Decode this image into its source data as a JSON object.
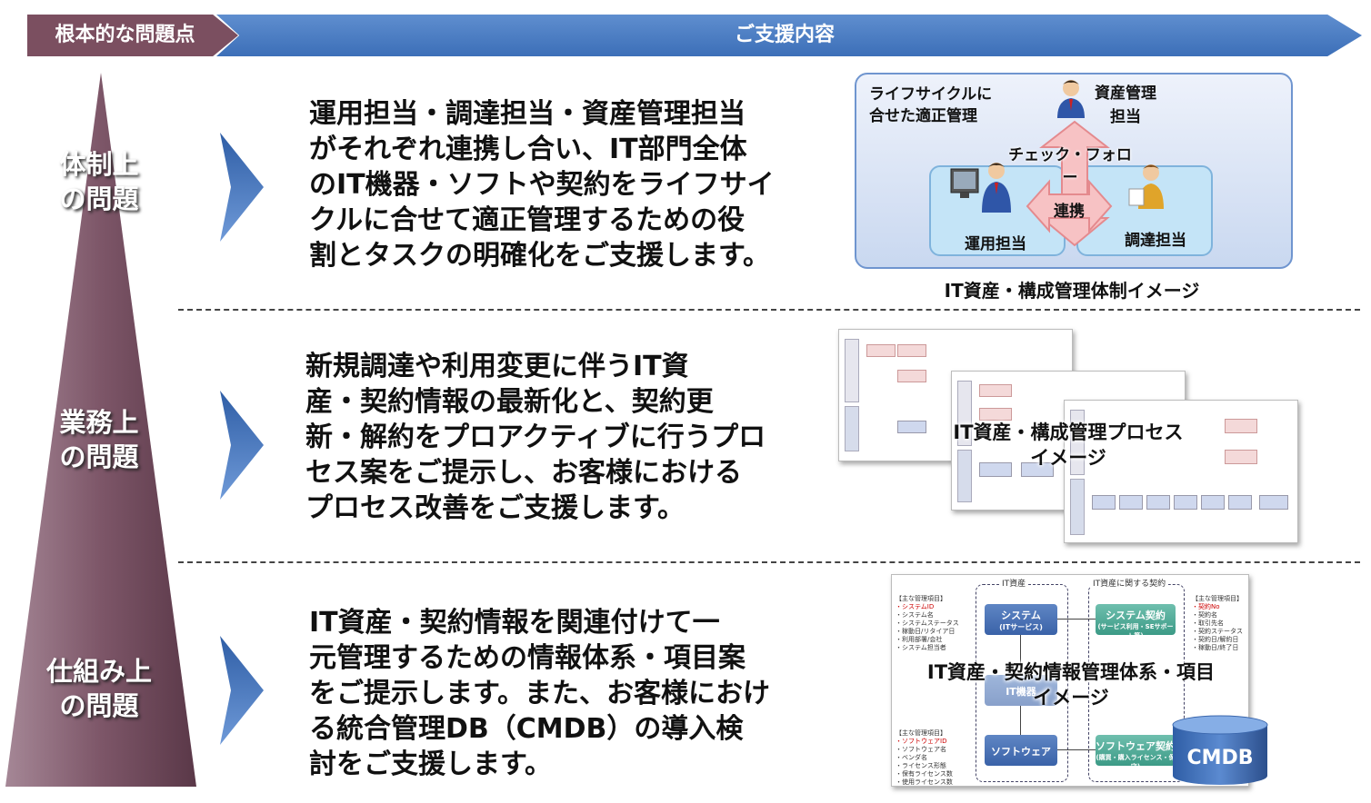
{
  "header": {
    "left": "根本的な問題点",
    "right": "ご支援内容"
  },
  "problems": [
    {
      "line1": "体制上",
      "line2": "の問題"
    },
    {
      "line1": "業務上",
      "line2": "の問題"
    },
    {
      "line1": "仕組み上",
      "line2": "の問題"
    }
  ],
  "support": [
    [
      "運用担当・調達担当・資産管理担当",
      "がそれぞれ連携し合い、IT部門全体",
      "のIT機器・ソフトや契約をライフサイ",
      "クルに合せて適正管理するための役",
      "割とタスクの明確化をご支援します。"
    ],
    [
      "新規調達や利用変更に伴うIT資",
      "産・契約情報の最新化と、契約更",
      "新・解約をプロアクティブに行うプロ",
      "セス案をご提示し、お客様における",
      "プロセス改善をご支援します。"
    ],
    [
      "IT資産・契約情報を関連付けて一",
      "元管理するための情報体系・項目案",
      "をご提示します。また、お客様におけ",
      "る統合管理DB（CMDB）の導入検",
      "討をご支援します。"
    ]
  ],
  "org_diagram": {
    "lifecycle_line1": "ライフサイクルに",
    "lifecycle_line2": "合せた適正管理",
    "asset_mgr_line1": "資産管理",
    "asset_mgr_line2": "担当",
    "check_follow": "チェック・フォロー",
    "link": "連携",
    "ops": "運用担当",
    "procurement": "調達担当",
    "caption": "IT資産・構成管理体制イメージ"
  },
  "process_image": {
    "overlay_line1": "IT資産・構成管理プロセス",
    "overlay_line2": "イメージ"
  },
  "info_image": {
    "overlay_line1": "IT資産・契約情報管理体系・項目",
    "overlay_line2": "イメージ",
    "group_it_assets": "IT資産",
    "group_contracts": "IT資産に関する契約",
    "system": "システム",
    "system_sub": "(ITサービス)",
    "system_contract": "システム契約",
    "system_contract_sub": "(サービス利用・SEサポート等)",
    "it_equipment": "IT機器",
    "software": "ソフトウェア",
    "software_contract": "ソフトウェア契約",
    "software_contract_sub": "(購買・購入ライセンス・保守)",
    "cmdb": "CMDB",
    "items_heading": "【主な管理項目】",
    "system_items": [
      "・システムID",
      "・システム名",
      "・システムステータス",
      "・稼動日/リタイア日",
      "・利用部署/会社",
      "・システム担当者"
    ],
    "contract_items": [
      "・契約No",
      "・契約名",
      "・取引先名",
      "・契約ステータス",
      "・契約日/解約日",
      "・稼動日/終了日"
    ],
    "software_items": [
      "・ソフトウェアID",
      "・ソフトウェア名",
      "・ベンダ名",
      "・ライセンス形態",
      "・保有ライセンス数",
      "・使用ライセンス数"
    ]
  },
  "colors": {
    "header_left": "#7b4f60",
    "header_right": "#4a7cc2",
    "pyramid": "#6b4656",
    "chevron": "#3f6fb5"
  }
}
